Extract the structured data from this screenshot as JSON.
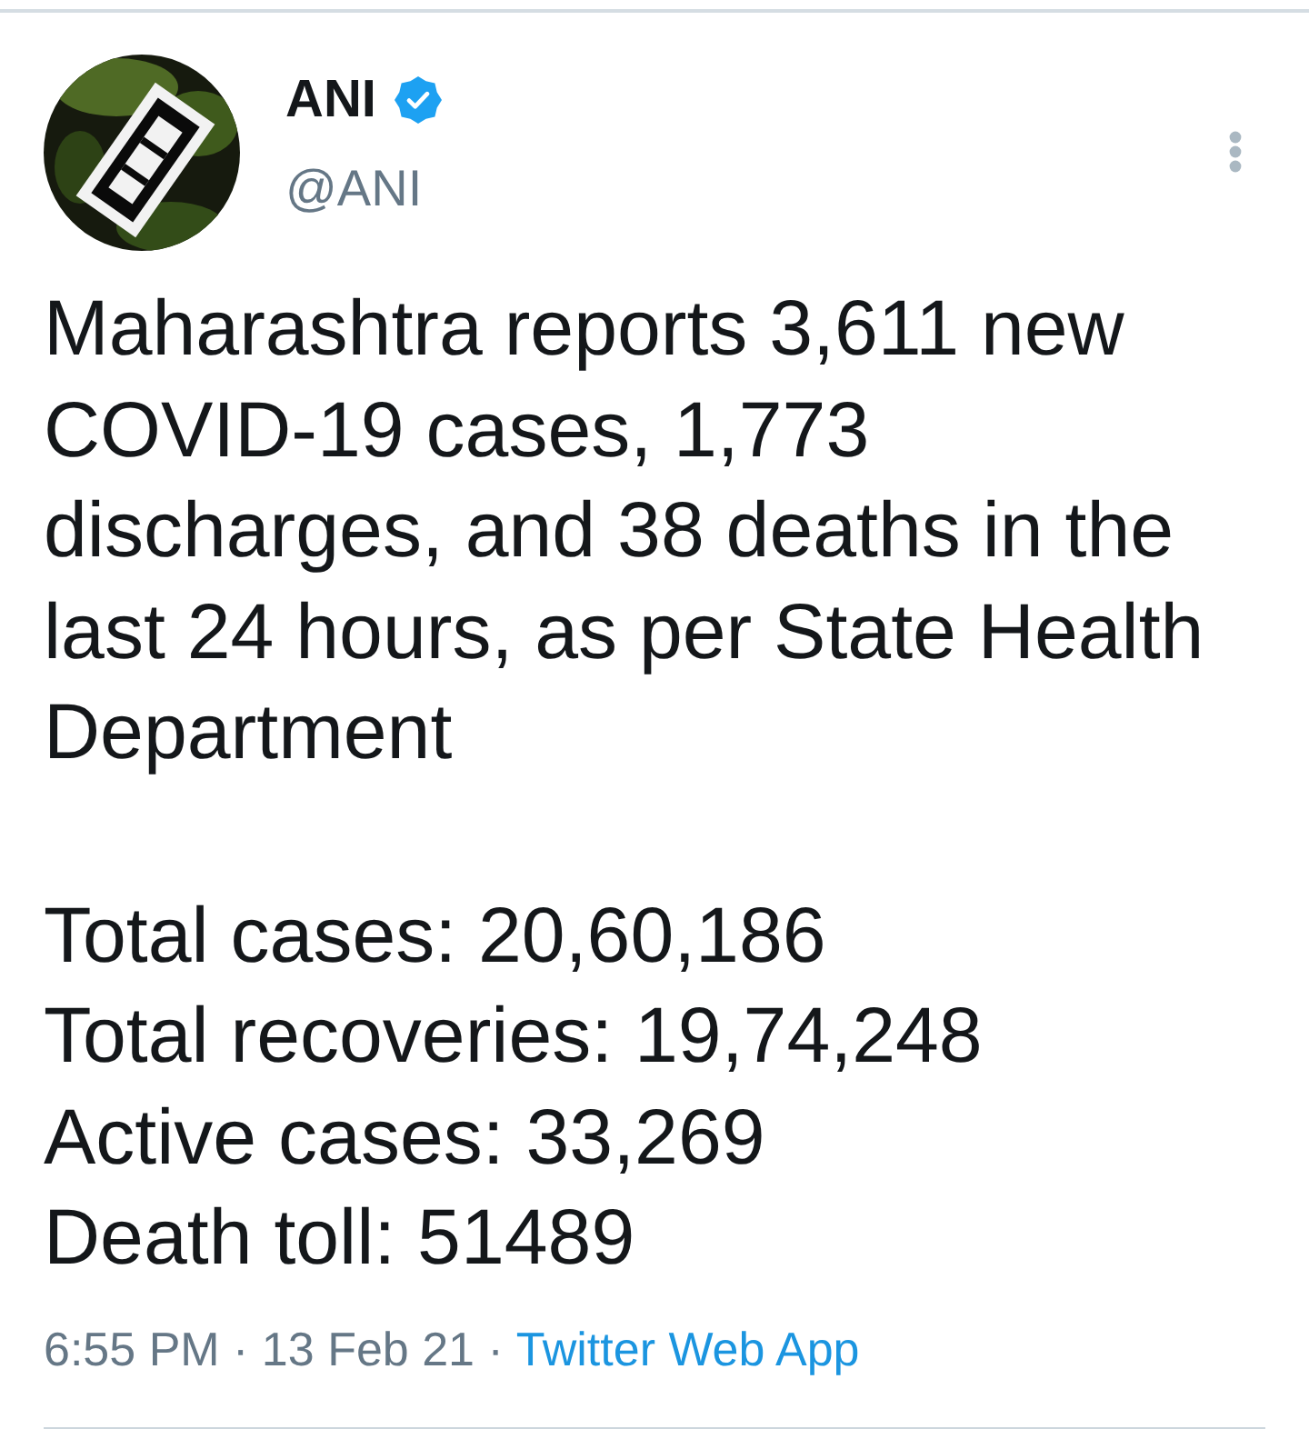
{
  "author": {
    "name": "ANI",
    "handle": "@ANI",
    "verified": true
  },
  "tweet": {
    "text": "Maharashtra reports 3,611 new COVID-19 cases, 1,773 discharges, and 38 deaths in the last 24 hours, as per State Health Department",
    "stats": [
      "Total cases: 20,60,186",
      "Total recoveries: 19,74,248",
      "Active cases: 33,269",
      "Death toll: 51489"
    ]
  },
  "meta": {
    "timestamp": "6:55 PM · 13 Feb 21 ·",
    "source": "Twitter Web App"
  }
}
